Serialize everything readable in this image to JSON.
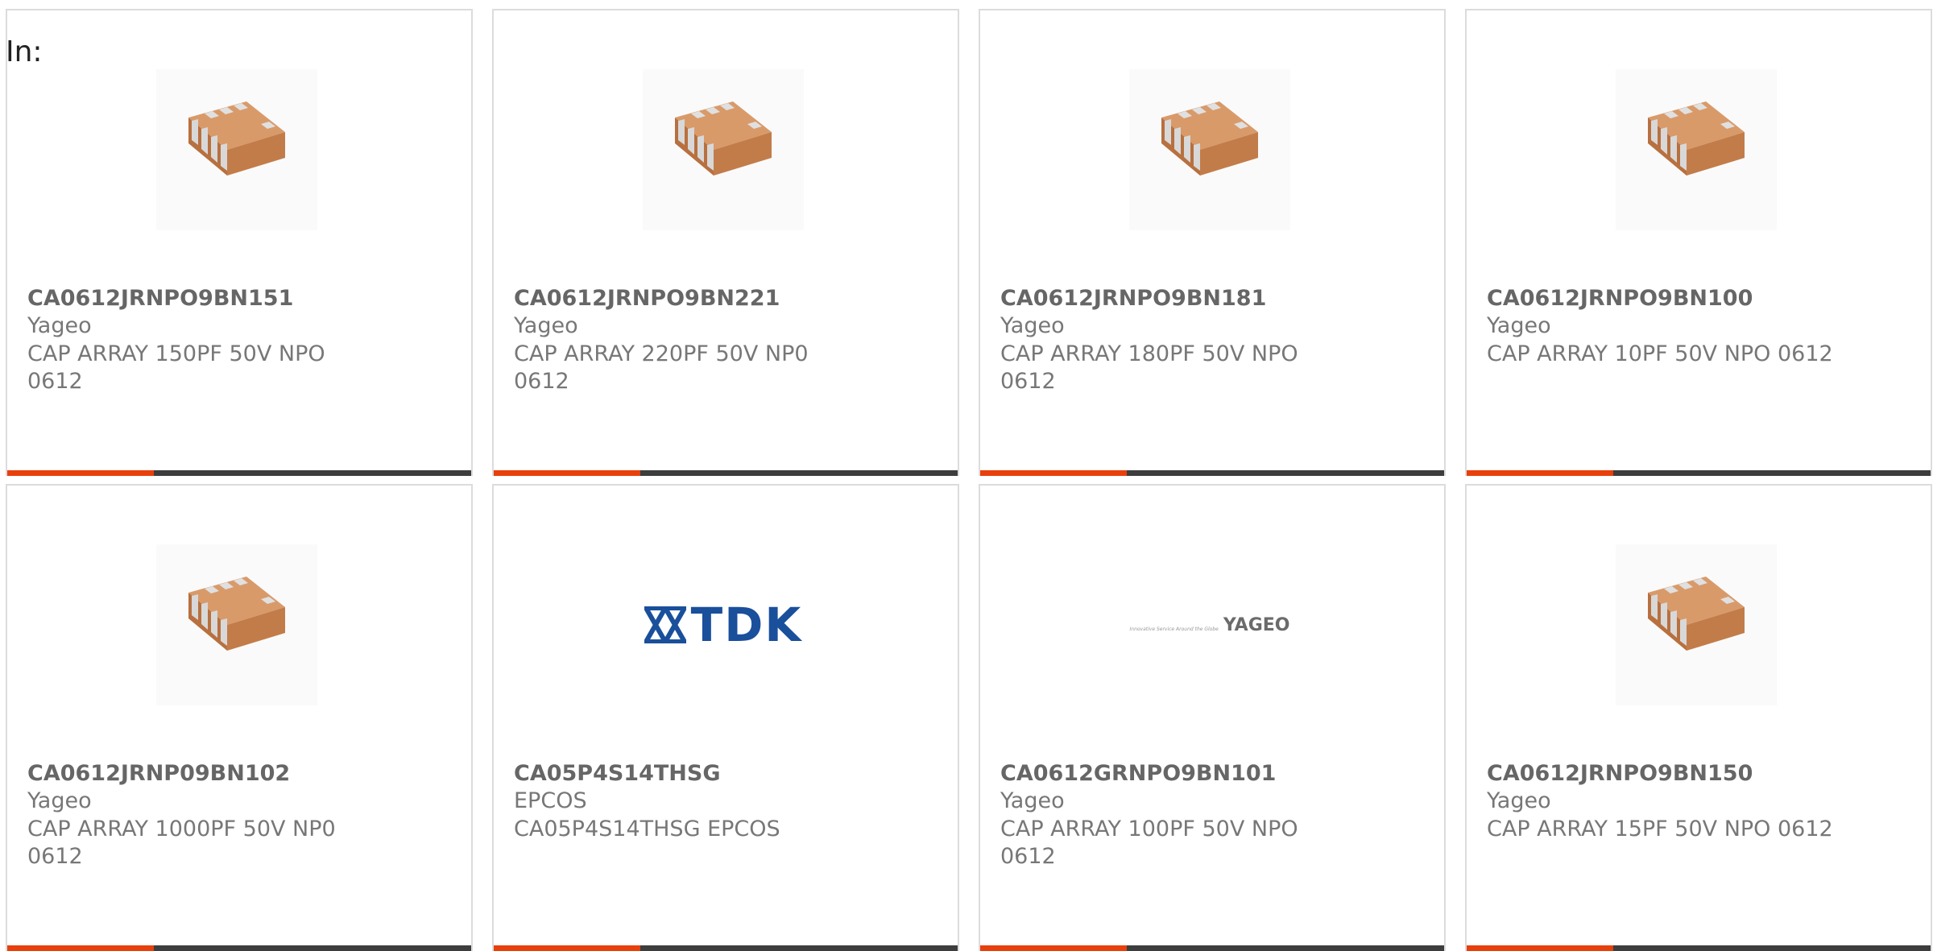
{
  "filter": {
    "label": "In:"
  },
  "colors": {
    "accent": "#e8400c",
    "bar": "#3d3d3d",
    "border": "#dcdcdc",
    "text": "#777777"
  },
  "products": [
    {
      "part_number": "CA0612JRNPO9BN151",
      "manufacturer": "Yageo",
      "description": "CAP ARRAY 150PF 50V NPO 0612",
      "image": "capacitor-array-chip"
    },
    {
      "part_number": "CA0612JRNPO9BN221",
      "manufacturer": "Yageo",
      "description": "CAP ARRAY 220PF 50V NP0 0612",
      "image": "capacitor-array-chip"
    },
    {
      "part_number": "CA0612JRNPO9BN181",
      "manufacturer": "Yageo",
      "description": "CAP ARRAY 180PF 50V NPO 0612",
      "image": "capacitor-array-chip"
    },
    {
      "part_number": "CA0612JRNPO9BN100",
      "manufacturer": "Yageo",
      "description": "CAP ARRAY 10PF 50V NPO 0612",
      "image": "capacitor-array-chip"
    },
    {
      "part_number": "CA0612JRNP09BN102",
      "manufacturer": "Yageo",
      "description": "CAP ARRAY 1000PF 50V NP0 0612",
      "image": "capacitor-array-chip"
    },
    {
      "part_number": "CA05P4S14THSG",
      "manufacturer": "EPCOS",
      "description": "CA05P4S14THSG EPCOS",
      "image": "tdk-logo",
      "logo_text": "TDK"
    },
    {
      "part_number": "CA0612GRNPO9BN101",
      "manufacturer": "Yageo",
      "description": "CAP ARRAY 100PF 50V NPO 0612",
      "image": "yageo-logo",
      "logo_text": "YAGEO",
      "logo_tagline": "Innovative Service Around the Globe"
    },
    {
      "part_number": "CA0612JRNPO9BN150",
      "manufacturer": "Yageo",
      "description": "CAP ARRAY 15PF 50V NPO 0612",
      "image": "capacitor-array-chip"
    }
  ]
}
